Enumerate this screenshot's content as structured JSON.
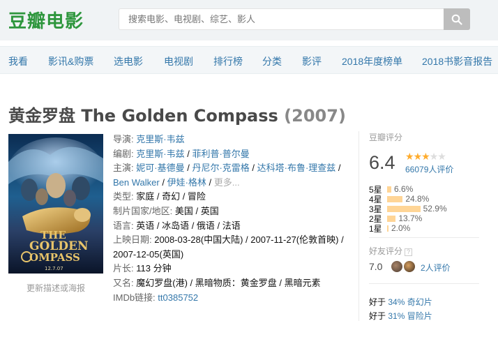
{
  "header": {
    "logo": "豆瓣电影",
    "search_placeholder": "搜索电影、电视剧、综艺、影人"
  },
  "nav": [
    "我看",
    "影讯&购票",
    "选电影",
    "电视剧",
    "排行榜",
    "分类",
    "影评",
    "2018年度榜单",
    "2018书影音报告"
  ],
  "movie": {
    "title": "黄金罗盘 The Golden Compass",
    "year": "(2007)",
    "poster_caption": "更新描述或海报",
    "director_label": "导演",
    "director": "克里斯·韦兹",
    "writer_label": "编剧",
    "writers": [
      "克里斯·韦兹",
      "菲利普·普尔曼"
    ],
    "cast_label": "主演",
    "cast": [
      "妮可·基德曼",
      "丹尼尔·克雷格",
      "达科塔·布鲁·理查兹",
      "Ben Walker",
      "伊娃·格林"
    ],
    "cast_more": "更多...",
    "genre_label": "类型:",
    "genres": "家庭 / 奇幻 / 冒险",
    "country_label": "制片国家/地区:",
    "country": "美国 / 英国",
    "language_label": "语言:",
    "language": "英语 / 冰岛语 / 俄语 / 法语",
    "release_label": "上映日期:",
    "release_1": "2008-03-28(中国大陆)",
    "release_2": "2007-11-27(伦敦首映)",
    "release_3": "2007-12-05(英国)",
    "runtime_label": "片长:",
    "runtime": "113 分钟",
    "aka_label": "又名:",
    "aka": "魔幻罗盘(港) / 黑暗物质：黄金罗盘 / 黑暗元素",
    "imdb_label": "IMDb链接:",
    "imdb": "tt0385752"
  },
  "rating": {
    "label": "豆瓣评分",
    "score": "6.4",
    "stars": 3,
    "votes": "66079人评价",
    "distribution": [
      {
        "label": "5星",
        "percent": 6.6,
        "text": "6.6%"
      },
      {
        "label": "4星",
        "percent": 24.8,
        "text": "24.8%"
      },
      {
        "label": "3星",
        "percent": 52.9,
        "text": "52.9%"
      },
      {
        "label": "2星",
        "percent": 13.7,
        "text": "13.7%"
      },
      {
        "label": "1星",
        "percent": 2.0,
        "text": "2.0%"
      }
    ],
    "friend_label": "好友评分",
    "friend_help": "?",
    "friend_score": "7.0",
    "friend_votes": "2人评价",
    "better_than": [
      {
        "prefix": "好于 ",
        "value": "34% 奇幻片"
      },
      {
        "prefix": "好于 ",
        "value": "31% 冒险片"
      }
    ]
  },
  "colors": {
    "logo": "#2e963d",
    "link": "#3377aa",
    "star": "#ffac2d",
    "bar": "#ffd596"
  }
}
